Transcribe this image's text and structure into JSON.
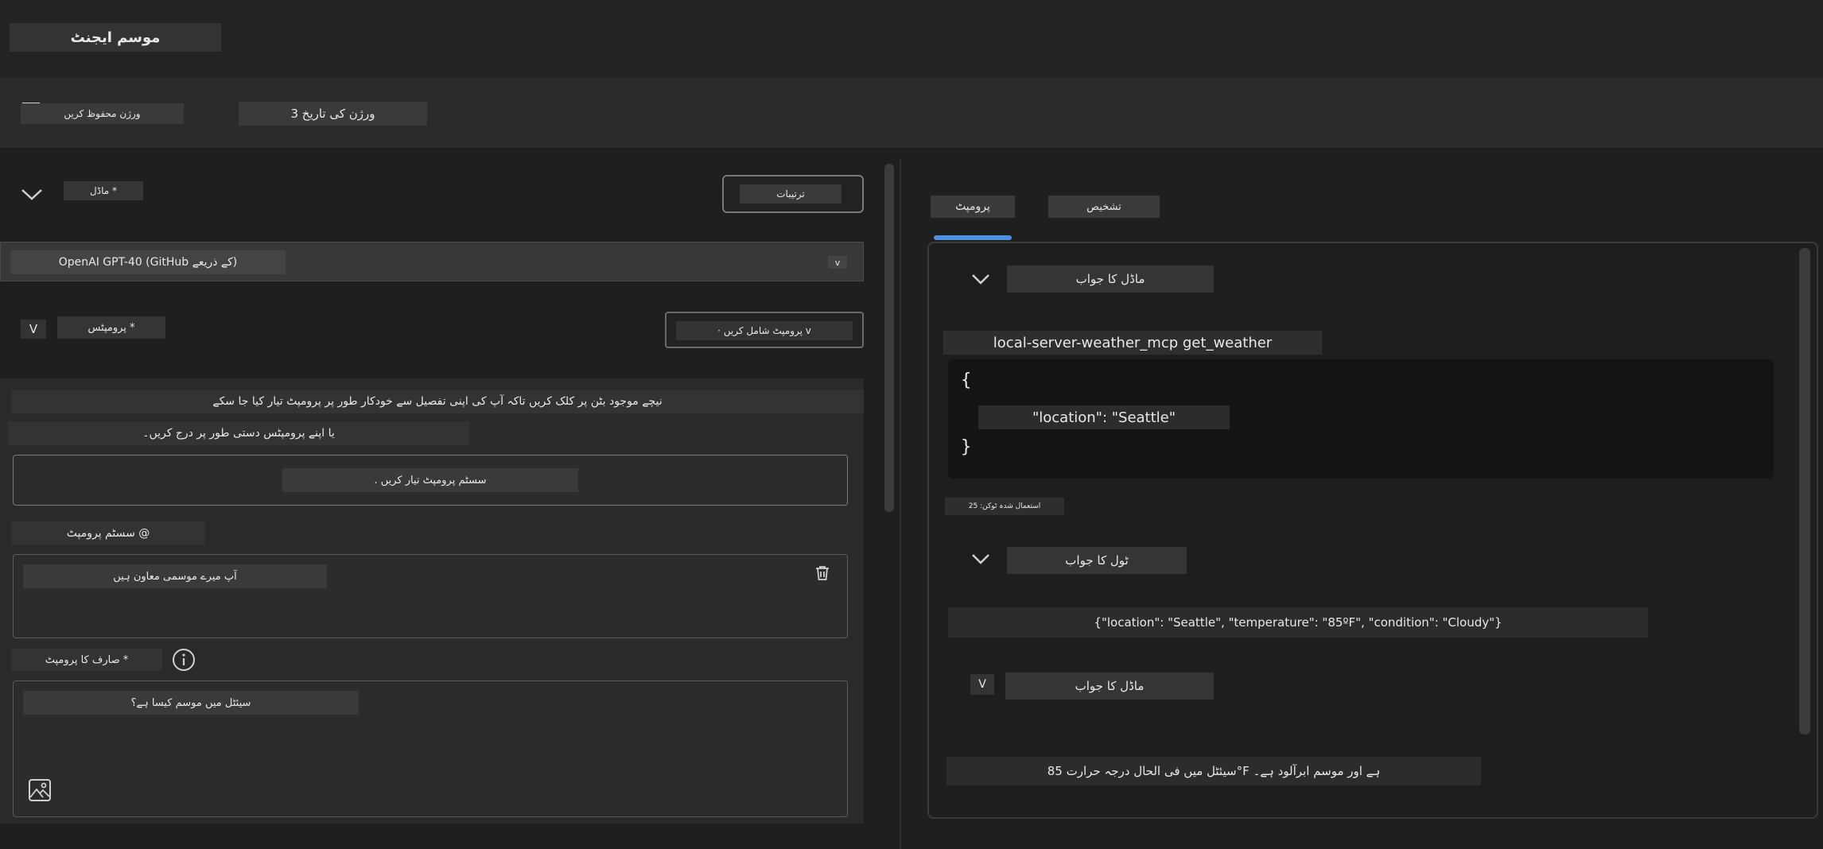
{
  "app": {
    "title": "موسم ایجنٹ"
  },
  "toolbar": {
    "save_version_label": "ورژن محفوظ کریں",
    "version_history_label": "3 ورژن کی تاریخ"
  },
  "model_section": {
    "label": "ماڈل *",
    "settings_label": "ترتیبات",
    "selected_model": "OpenAI GPT-40 (GitHub کے ذریعے)",
    "dropdown_glyph": "v"
  },
  "prompts_section": {
    "label": "پرومپٹس *",
    "collapse_glyph": "V",
    "add_prompt_label": "· پرومپٹ شامل کریں v",
    "instruction_line1": "نیچے موجود بٹن پر کلک کریں تاکہ آپ کی اپنی تفصیل سے خودکار طور پر پرومپٹ تیار کیا جا سکے",
    "instruction_line2": "یا اپنے پرومپٹس دستی طور پر درج کریں۔",
    "generate_button_label": ". سسٹم پرومپٹ تیار کریں",
    "system_prompt_label": "سسٹم پرومپٹ @",
    "system_prompt_value": "آپ میرے موسمی معاون ہیں",
    "user_prompt_label": "صارف کا پرومپٹ *",
    "user_prompt_value": "سیئٹل میں موسم کیسا ہے؟"
  },
  "right_pane": {
    "tabs": [
      {
        "label": "پرومپٹ",
        "active": true
      },
      {
        "label": "تشخیص",
        "active": false
      }
    ],
    "model_response_title": "ماڈل کا جواب",
    "tool_call_name": "local-server-weather_mcp get_weather",
    "code_open": "{",
    "code_line": "\"location\": \"Seattle\"",
    "code_close": "}",
    "tokens_used": "استعمال شدہ ٹوکن: 25",
    "tool_response_title": "ٹول کا جواب",
    "tool_response_value": "{\"location\": \"Seattle\", \"temperature\": \"85ºF\", \"condition\": \"Cloudy\"}",
    "model_response_title_2": "ماڈل کا جواب",
    "model_response_glyph": "V",
    "final_answer": "سیئٹل میں فی الحال درجہ حرارت 85°F ہے اور موسم ابرآلود ہے۔"
  },
  "colors": {
    "background": "#1f1f1f",
    "accent_tab": "#4f8fe0",
    "panel": "#353535"
  }
}
